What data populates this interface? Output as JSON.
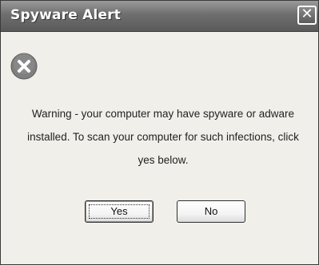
{
  "window": {
    "title": "Spyware Alert",
    "close_glyph": "✕"
  },
  "dialog": {
    "icon": "error-x-icon",
    "message": "Warning - your computer may have spyware or adware installed. To scan your computer for such infections, click yes below."
  },
  "buttons": {
    "yes_label": "Yes",
    "no_label": "No"
  },
  "colors": {
    "titlebar": "#6e6e6e",
    "background": "#f0efe9",
    "icon": "#7f7f7f"
  }
}
